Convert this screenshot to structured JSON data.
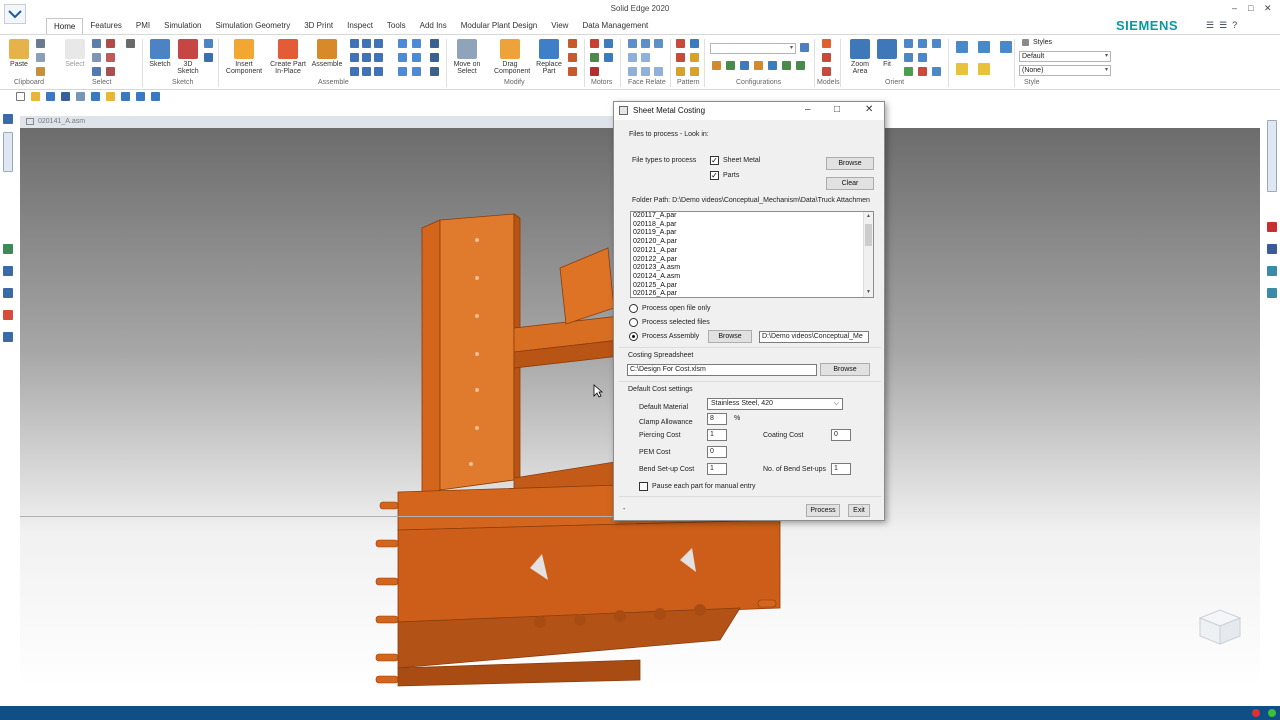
{
  "app": {
    "title": "Solid Edge 2020",
    "brand": "SIEMENS",
    "window_controls": [
      "–",
      "□",
      "✕"
    ]
  },
  "ribbon": {
    "tabs": [
      "Home",
      "Features",
      "PMI",
      "Simulation",
      "Simulation Geometry",
      "3D Print",
      "Inspect",
      "Tools",
      "Add Ins",
      "Modular Plant Design",
      "View",
      "Data Management"
    ],
    "buttons": {
      "paste": "Paste",
      "select": "Select",
      "sketch": "Sketch",
      "sketch3d": "3D Sketch",
      "insert_component": "Insert Component",
      "create_part": "Create Part In-Place",
      "assemble": "Assemble",
      "move_on_select": "Move on Select",
      "drag_component": "Drag Component",
      "replace_part": "Replace Part",
      "zoom_area": "Zoom Area",
      "fit": "Fit"
    },
    "groups": [
      "Clipboard",
      "Select",
      "Sketch",
      "Assemble",
      "Modify",
      "Motors",
      "Face Relate",
      "Pattern",
      "Configurations",
      "Models",
      "Orient",
      "Style"
    ],
    "styles_label": "Styles",
    "style_value": "Default",
    "style_value2": "(None)"
  },
  "document": {
    "tab_name": "020141_A.asm"
  },
  "dialog": {
    "title": "Sheet Metal Costing",
    "files_to_process": "Files to process - Look in:",
    "file_types_label": "File types to process",
    "types": [
      {
        "label": "Sheet Metal",
        "checked": true
      },
      {
        "label": "Parts",
        "checked": true
      }
    ],
    "browse": "Browse",
    "clear": "Clear",
    "folder_path": "Folder Path: D:\\Demo videos\\Conceptual_Mechanism\\Data\\Truck Attachmen",
    "files": [
      "020117_A.par",
      "020118_A.par",
      "020119_A.par",
      "020120_A.par",
      "020121_A.par",
      "020122_A.par",
      "020123_A.asm",
      "020124_A.asm",
      "020125_A.par",
      "020126_A.par"
    ],
    "process_options": [
      "Process open file only",
      "Process selected files",
      "Process Assembly"
    ],
    "assembly_path": "D:\\Demo videos\\Conceptual_Me",
    "costing_spreadsheet_label": "Costing Spreadsheet",
    "spreadsheet_path": "C:\\Design For Cost.xlsm",
    "default_cost_label": "Default Cost settings",
    "default_material_label": "Default Material",
    "default_material": "Stainless Steel, 420",
    "clamp_allowance_label": "Clamp Allowance",
    "clamp_allowance": "8",
    "percent": "%",
    "piercing_cost_label": "Piercing Cost",
    "piercing_cost": "1",
    "coating_cost_label": "Coating Cost",
    "coating_cost": "0",
    "pem_cost_label": "PEM Cost",
    "pem_cost": "0",
    "bend_setup_cost_label": "Bend Set-up Cost",
    "bend_setup_cost": "1",
    "bend_setups_label": "No. of Bend Set-ups",
    "bend_setups": "1",
    "pause_label": "Pause each part for manual entry",
    "status": "-",
    "process": "Process",
    "exit": "Exit"
  },
  "colors": {
    "model_orange": "#d4651c",
    "status_bar": "#0f4f85",
    "siemens_teal": "#079aa5"
  }
}
